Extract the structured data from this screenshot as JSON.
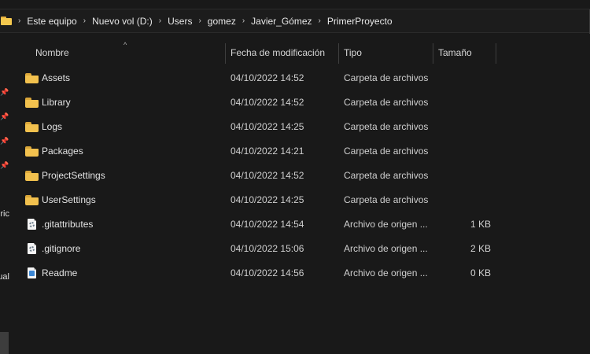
{
  "breadcrumbs": [
    "Este equipo",
    "Nuevo vol (D:)",
    "Users",
    "gomez",
    "Javier_Gómez",
    "PrimerProyecto"
  ],
  "nav_clipped_labels": [
    "ric",
    "ual"
  ],
  "columns": {
    "name": "Nombre",
    "date": "Fecha de modificación",
    "type": "Tipo",
    "size": "Tamaño"
  },
  "files": [
    {
      "name": "Assets",
      "date": "04/10/2022 14:52",
      "type": "Carpeta de archivos",
      "size": "",
      "icon": "folder-icon"
    },
    {
      "name": "Library",
      "date": "04/10/2022 14:52",
      "type": "Carpeta de archivos",
      "size": "",
      "icon": "folder-icon"
    },
    {
      "name": "Logs",
      "date": "04/10/2022 14:25",
      "type": "Carpeta de archivos",
      "size": "",
      "icon": "folder-icon"
    },
    {
      "name": "Packages",
      "date": "04/10/2022 14:21",
      "type": "Carpeta de archivos",
      "size": "",
      "icon": "folder-icon"
    },
    {
      "name": "ProjectSettings",
      "date": "04/10/2022 14:52",
      "type": "Carpeta de archivos",
      "size": "",
      "icon": "folder-icon"
    },
    {
      "name": "UserSettings",
      "date": "04/10/2022 14:25",
      "type": "Carpeta de archivos",
      "size": "",
      "icon": "folder-icon"
    },
    {
      "name": ".gitattributes",
      "date": "04/10/2022 14:54",
      "type": "Archivo de origen ...",
      "size": "1 KB",
      "icon": "source-file-icon"
    },
    {
      "name": ".gitignore",
      "date": "04/10/2022 15:06",
      "type": "Archivo de origen ...",
      "size": "2 KB",
      "icon": "source-file-icon"
    },
    {
      "name": "Readme",
      "date": "04/10/2022 14:56",
      "type": "Archivo de origen ...",
      "size": "0 KB",
      "icon": "markdown-file-icon"
    }
  ]
}
